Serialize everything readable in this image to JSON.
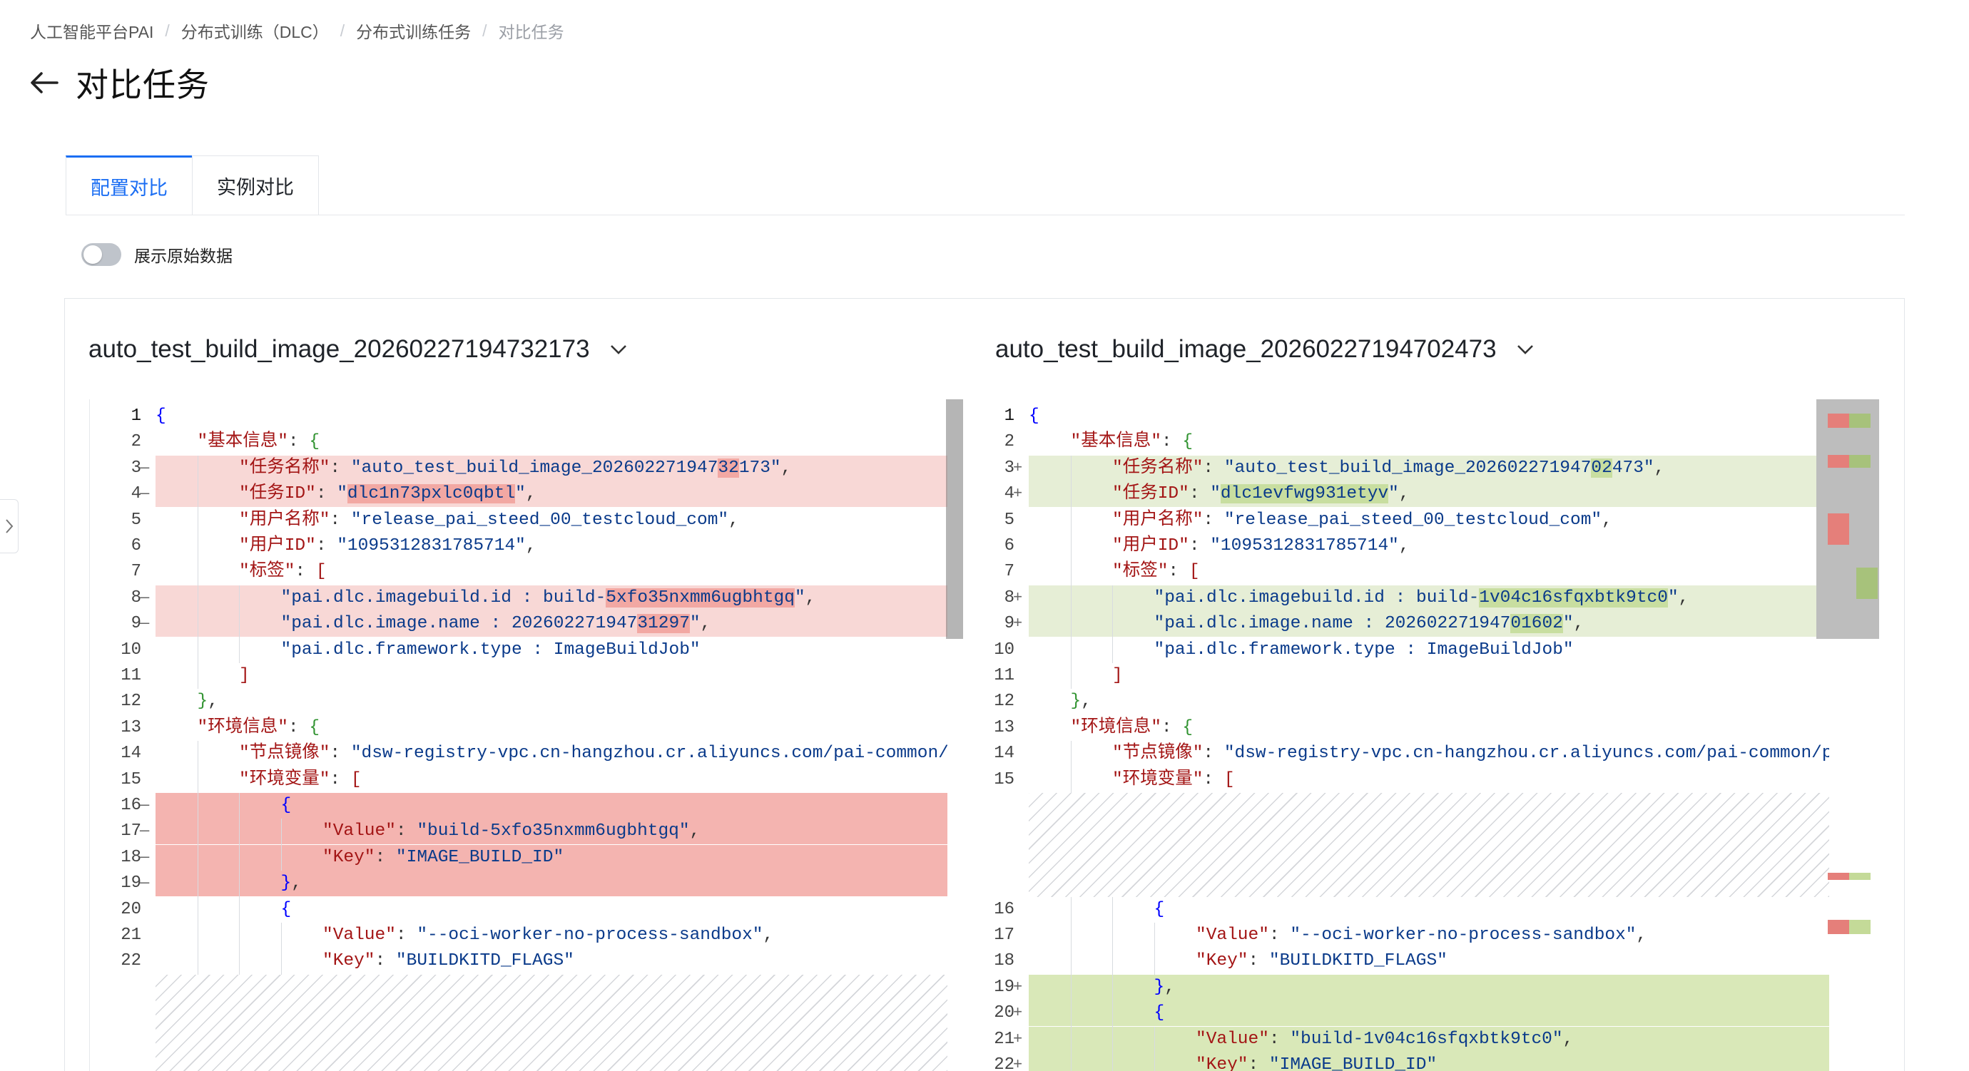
{
  "breadcrumb": [
    "人工智能平台PAI",
    "分布式训练（DLC）",
    "分布式训练任务",
    "对比任务"
  ],
  "page_title": "对比任务",
  "tabs": [
    {
      "label": "配置对比",
      "active": true
    },
    {
      "label": "实例对比",
      "active": false
    }
  ],
  "toggle": {
    "label": "展示原始数据",
    "checked": false
  },
  "colors": {
    "accent": "#1b6ef3",
    "deleted_line": "#f8d8d6",
    "deleted_block": "#f4b4b0",
    "inserted_line": "#e6eed6",
    "inserted_block": "#d9e8b8"
  },
  "left": {
    "title": "auto_test_build_image_20260227194732173",
    "lines": [
      {
        "n": "1",
        "m": "",
        "bg": "",
        "indent": 0,
        "parts": [
          {
            "t": "{",
            "c": "tk-b1"
          }
        ]
      },
      {
        "n": "2",
        "m": "",
        "bg": "",
        "indent": 1,
        "parts": [
          {
            "t": "\"基本信息\"",
            "c": "tk-key"
          },
          {
            "t": ": ",
            "c": "tk-p"
          },
          {
            "t": "{",
            "c": "tk-b2"
          }
        ]
      },
      {
        "n": "3",
        "m": "—",
        "bg": "bg-del",
        "indent": 2,
        "parts": [
          {
            "t": "\"任务名称\"",
            "c": "tk-key"
          },
          {
            "t": ": ",
            "c": "tk-p"
          },
          {
            "t": "\"auto_test_build_image_202602271947",
            "c": "tk-str"
          },
          {
            "t": "32",
            "c": "tk-str hl-del"
          },
          {
            "t": "173\"",
            "c": "tk-str"
          },
          {
            "t": ",",
            "c": "tk-p"
          }
        ]
      },
      {
        "n": "4",
        "m": "—",
        "bg": "bg-del",
        "indent": 2,
        "parts": [
          {
            "t": "\"任务ID\"",
            "c": "tk-key"
          },
          {
            "t": ": ",
            "c": "tk-p"
          },
          {
            "t": "\"",
            "c": "tk-str"
          },
          {
            "t": "dlc1n73pxlc0qbtl",
            "c": "tk-str hl-del"
          },
          {
            "t": "\"",
            "c": "tk-str"
          },
          {
            "t": ",",
            "c": "tk-p"
          }
        ]
      },
      {
        "n": "5",
        "m": "",
        "bg": "",
        "indent": 2,
        "parts": [
          {
            "t": "\"用户名称\"",
            "c": "tk-key"
          },
          {
            "t": ": ",
            "c": "tk-p"
          },
          {
            "t": "\"release_pai_steed_00_testcloud_com\"",
            "c": "tk-str"
          },
          {
            "t": ",",
            "c": "tk-p"
          }
        ]
      },
      {
        "n": "6",
        "m": "",
        "bg": "",
        "indent": 2,
        "parts": [
          {
            "t": "\"用户ID\"",
            "c": "tk-key"
          },
          {
            "t": ": ",
            "c": "tk-p"
          },
          {
            "t": "\"1095312831785714\"",
            "c": "tk-str"
          },
          {
            "t": ",",
            "c": "tk-p"
          }
        ]
      },
      {
        "n": "7",
        "m": "",
        "bg": "",
        "indent": 2,
        "parts": [
          {
            "t": "\"标签\"",
            "c": "tk-key"
          },
          {
            "t": ": ",
            "c": "tk-p"
          },
          {
            "t": "[",
            "c": "tk-b3"
          }
        ]
      },
      {
        "n": "8",
        "m": "—",
        "bg": "bg-del",
        "indent": 3,
        "parts": [
          {
            "t": "\"pai.dlc.imagebuild.id : build-",
            "c": "tk-str"
          },
          {
            "t": "5xfo35nxmm6ugbhtgq",
            "c": "tk-str hl-del"
          },
          {
            "t": "\"",
            "c": "tk-str"
          },
          {
            "t": ",",
            "c": "tk-p"
          }
        ]
      },
      {
        "n": "9",
        "m": "—",
        "bg": "bg-del",
        "indent": 3,
        "parts": [
          {
            "t": "\"pai.dlc.image.name : 202602271947",
            "c": "tk-str"
          },
          {
            "t": "31297",
            "c": "tk-str hl-del"
          },
          {
            "t": "\"",
            "c": "tk-str"
          },
          {
            "t": ",",
            "c": "tk-p"
          }
        ]
      },
      {
        "n": "10",
        "m": "",
        "bg": "",
        "indent": 3,
        "parts": [
          {
            "t": "\"pai.dlc.framework.type : ImageBuildJob\"",
            "c": "tk-str"
          }
        ]
      },
      {
        "n": "11",
        "m": "",
        "bg": "",
        "indent": 2,
        "parts": [
          {
            "t": "]",
            "c": "tk-b3"
          }
        ]
      },
      {
        "n": "12",
        "m": "",
        "bg": "",
        "indent": 1,
        "parts": [
          {
            "t": "}",
            "c": "tk-b2"
          },
          {
            "t": ",",
            "c": "tk-p"
          }
        ]
      },
      {
        "n": "13",
        "m": "",
        "bg": "",
        "indent": 1,
        "parts": [
          {
            "t": "\"环境信息\"",
            "c": "tk-key"
          },
          {
            "t": ": ",
            "c": "tk-p"
          },
          {
            "t": "{",
            "c": "tk-b2"
          }
        ]
      },
      {
        "n": "14",
        "m": "",
        "bg": "",
        "indent": 2,
        "parts": [
          {
            "t": "\"节点镜像\"",
            "c": "tk-key"
          },
          {
            "t": ": ",
            "c": "tk-p"
          },
          {
            "t": "\"dsw-registry-vpc.cn-hangzhou.cr.aliyuncs.com/pai-common/pai",
            "c": "tk-str"
          }
        ]
      },
      {
        "n": "15",
        "m": "",
        "bg": "",
        "indent": 2,
        "parts": [
          {
            "t": "\"环境变量\"",
            "c": "tk-key"
          },
          {
            "t": ": ",
            "c": "tk-p"
          },
          {
            "t": "[",
            "c": "tk-b3"
          }
        ]
      },
      {
        "n": "16",
        "m": "—",
        "bg": "bg-del-strong",
        "indent": 3,
        "parts": [
          {
            "t": "{",
            "c": "tk-b1"
          }
        ]
      },
      {
        "n": "17",
        "m": "—",
        "bg": "bg-del-strong",
        "indent": 4,
        "parts": [
          {
            "t": "\"Value\"",
            "c": "tk-key"
          },
          {
            "t": ": ",
            "c": "tk-p"
          },
          {
            "t": "\"build-5xfo35nxmm6ugbhtgq\"",
            "c": "tk-str"
          },
          {
            "t": ",",
            "c": "tk-p"
          }
        ]
      },
      {
        "n": "18",
        "m": "—",
        "bg": "bg-del-strong",
        "indent": 4,
        "parts": [
          {
            "t": "\"Key\"",
            "c": "tk-key"
          },
          {
            "t": ": ",
            "c": "tk-p"
          },
          {
            "t": "\"IMAGE_BUILD_ID\"",
            "c": "tk-str"
          }
        ]
      },
      {
        "n": "19",
        "m": "—",
        "bg": "bg-del-strong",
        "indent": 3,
        "parts": [
          {
            "t": "}",
            "c": "tk-b1"
          },
          {
            "t": ",",
            "c": "tk-p"
          }
        ]
      },
      {
        "n": "20",
        "m": "",
        "bg": "",
        "indent": 3,
        "parts": [
          {
            "t": "{",
            "c": "tk-b1"
          }
        ]
      },
      {
        "n": "21",
        "m": "",
        "bg": "",
        "indent": 4,
        "parts": [
          {
            "t": "\"Value\"",
            "c": "tk-key"
          },
          {
            "t": ": ",
            "c": "tk-p"
          },
          {
            "t": "\"--oci-worker-no-process-sandbox\"",
            "c": "tk-str"
          },
          {
            "t": ",",
            "c": "tk-p"
          }
        ]
      },
      {
        "n": "22",
        "m": "",
        "bg": "",
        "indent": 4,
        "parts": [
          {
            "t": "\"Key\"",
            "c": "tk-key"
          },
          {
            "t": ": ",
            "c": "tk-p"
          },
          {
            "t": "\"BUILDKITD_FLAGS\"",
            "c": "tk-str"
          }
        ]
      },
      {
        "spacer": 4
      }
    ]
  },
  "right": {
    "title": "auto_test_build_image_20260227194702473",
    "lines": [
      {
        "n": "1",
        "m": "",
        "bg": "",
        "indent": 0,
        "parts": [
          {
            "t": "{",
            "c": "tk-b1"
          }
        ]
      },
      {
        "n": "2",
        "m": "",
        "bg": "",
        "indent": 1,
        "parts": [
          {
            "t": "\"基本信息\"",
            "c": "tk-key"
          },
          {
            "t": ": ",
            "c": "tk-p"
          },
          {
            "t": "{",
            "c": "tk-b2"
          }
        ]
      },
      {
        "n": "3",
        "m": "+",
        "bg": "bg-ins",
        "indent": 2,
        "parts": [
          {
            "t": "\"任务名称\"",
            "c": "tk-key"
          },
          {
            "t": ": ",
            "c": "tk-p"
          },
          {
            "t": "\"auto_test_build_image_202602271947",
            "c": "tk-str"
          },
          {
            "t": "02",
            "c": "tk-str hl-ins"
          },
          {
            "t": "473\"",
            "c": "tk-str"
          },
          {
            "t": ",",
            "c": "tk-p"
          }
        ]
      },
      {
        "n": "4",
        "m": "+",
        "bg": "bg-ins",
        "indent": 2,
        "parts": [
          {
            "t": "\"任务ID\"",
            "c": "tk-key"
          },
          {
            "t": ": ",
            "c": "tk-p"
          },
          {
            "t": "\"",
            "c": "tk-str"
          },
          {
            "t": "dlc1evfwg931etyv",
            "c": "tk-str hl-ins"
          },
          {
            "t": "\"",
            "c": "tk-str"
          },
          {
            "t": ",",
            "c": "tk-p"
          }
        ]
      },
      {
        "n": "5",
        "m": "",
        "bg": "",
        "indent": 2,
        "parts": [
          {
            "t": "\"用户名称\"",
            "c": "tk-key"
          },
          {
            "t": ": ",
            "c": "tk-p"
          },
          {
            "t": "\"release_pai_steed_00_testcloud_com\"",
            "c": "tk-str"
          },
          {
            "t": ",",
            "c": "tk-p"
          }
        ]
      },
      {
        "n": "6",
        "m": "",
        "bg": "",
        "indent": 2,
        "parts": [
          {
            "t": "\"用户ID\"",
            "c": "tk-key"
          },
          {
            "t": ": ",
            "c": "tk-p"
          },
          {
            "t": "\"1095312831785714\"",
            "c": "tk-str"
          },
          {
            "t": ",",
            "c": "tk-p"
          }
        ]
      },
      {
        "n": "7",
        "m": "",
        "bg": "",
        "indent": 2,
        "parts": [
          {
            "t": "\"标签\"",
            "c": "tk-key"
          },
          {
            "t": ": ",
            "c": "tk-p"
          },
          {
            "t": "[",
            "c": "tk-b3"
          }
        ]
      },
      {
        "n": "8",
        "m": "+",
        "bg": "bg-ins",
        "indent": 3,
        "parts": [
          {
            "t": "\"pai.dlc.imagebuild.id : build-",
            "c": "tk-str"
          },
          {
            "t": "1v04c16sfqxbtk9tc0",
            "c": "tk-str hl-ins"
          },
          {
            "t": "\"",
            "c": "tk-str"
          },
          {
            "t": ",",
            "c": "tk-p"
          }
        ]
      },
      {
        "n": "9",
        "m": "+",
        "bg": "bg-ins",
        "indent": 3,
        "parts": [
          {
            "t": "\"pai.dlc.image.name : 202602271947",
            "c": "tk-str"
          },
          {
            "t": "01602",
            "c": "tk-str hl-ins"
          },
          {
            "t": "\"",
            "c": "tk-str"
          },
          {
            "t": ",",
            "c": "tk-p"
          }
        ]
      },
      {
        "n": "10",
        "m": "",
        "bg": "",
        "indent": 3,
        "parts": [
          {
            "t": "\"pai.dlc.framework.type : ImageBuildJob\"",
            "c": "tk-str"
          }
        ]
      },
      {
        "n": "11",
        "m": "",
        "bg": "",
        "indent": 2,
        "parts": [
          {
            "t": "]",
            "c": "tk-b3"
          }
        ]
      },
      {
        "n": "12",
        "m": "",
        "bg": "",
        "indent": 1,
        "parts": [
          {
            "t": "}",
            "c": "tk-b2"
          },
          {
            "t": ",",
            "c": "tk-p"
          }
        ]
      },
      {
        "n": "13",
        "m": "",
        "bg": "",
        "indent": 1,
        "parts": [
          {
            "t": "\"环境信息\"",
            "c": "tk-key"
          },
          {
            "t": ": ",
            "c": "tk-p"
          },
          {
            "t": "{",
            "c": "tk-b2"
          }
        ]
      },
      {
        "n": "14",
        "m": "",
        "bg": "",
        "indent": 2,
        "parts": [
          {
            "t": "\"节点镜像\"",
            "c": "tk-key"
          },
          {
            "t": ": ",
            "c": "tk-p"
          },
          {
            "t": "\"dsw-registry-vpc.cn-hangzhou.cr.aliyuncs.com/pai-common/pai",
            "c": "tk-str"
          }
        ]
      },
      {
        "n": "15",
        "m": "",
        "bg": "",
        "indent": 2,
        "parts": [
          {
            "t": "\"环境变量\"",
            "c": "tk-key"
          },
          {
            "t": ": ",
            "c": "tk-p"
          },
          {
            "t": "[",
            "c": "tk-b3"
          }
        ]
      },
      {
        "spacer": 4
      },
      {
        "n": "16",
        "m": "",
        "bg": "",
        "indent": 3,
        "parts": [
          {
            "t": "{",
            "c": "tk-b1"
          }
        ]
      },
      {
        "n": "17",
        "m": "",
        "bg": "",
        "indent": 4,
        "parts": [
          {
            "t": "\"Value\"",
            "c": "tk-key"
          },
          {
            "t": ": ",
            "c": "tk-p"
          },
          {
            "t": "\"--oci-worker-no-process-sandbox\"",
            "c": "tk-str"
          },
          {
            "t": ",",
            "c": "tk-p"
          }
        ]
      },
      {
        "n": "18",
        "m": "",
        "bg": "",
        "indent": 4,
        "parts": [
          {
            "t": "\"Key\"",
            "c": "tk-key"
          },
          {
            "t": ": ",
            "c": "tk-p"
          },
          {
            "t": "\"BUILDKITD_FLAGS\"",
            "c": "tk-str"
          }
        ]
      },
      {
        "n": "19",
        "m": "+",
        "bg": "bg-ins-strong",
        "indent": 3,
        "parts": [
          {
            "t": "}",
            "c": "tk-b1"
          },
          {
            "t": ",",
            "c": "tk-p"
          }
        ]
      },
      {
        "n": "20",
        "m": "+",
        "bg": "bg-ins-strong",
        "indent": 3,
        "parts": [
          {
            "t": "{",
            "c": "tk-b1"
          }
        ]
      },
      {
        "n": "21",
        "m": "+",
        "bg": "bg-ins-strong",
        "indent": 4,
        "parts": [
          {
            "t": "\"Value\"",
            "c": "tk-key"
          },
          {
            "t": ": ",
            "c": "tk-p"
          },
          {
            "t": "\"build-1v04c16sfqxbtk9tc0\"",
            "c": "tk-str"
          },
          {
            "t": ",",
            "c": "tk-p"
          }
        ]
      },
      {
        "n": "22",
        "m": "+",
        "bg": "bg-ins-strong",
        "indent": 4,
        "parts": [
          {
            "t": "\"Key\"",
            "c": "tk-key"
          },
          {
            "t": ": ",
            "c": "tk-p"
          },
          {
            "t": "\"IMAGE_BUILD_ID\"",
            "c": "tk-str"
          }
        ]
      }
    ]
  }
}
